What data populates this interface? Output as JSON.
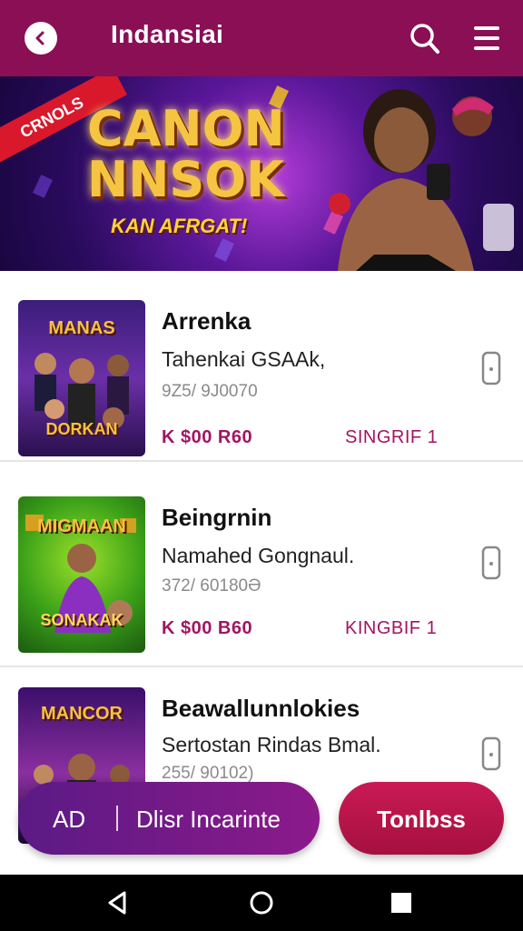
{
  "header": {
    "title": "Indansiai",
    "back_icon": "back-arrow-icon",
    "search_icon": "search-icon",
    "menu_icon": "hamburger-menu-icon",
    "bg_color": "#8a0f55"
  },
  "banner": {
    "ribbon": "CRNOLS",
    "headline_1": "CANON",
    "headline_2": "NNSOK",
    "subline": "KAN AFRGAT!"
  },
  "items": [
    {
      "thumb_top": "MANAS",
      "thumb_bottom": "DORKAN",
      "title": "Arrenka",
      "description": "Tahenkai GSAAk,",
      "meta": "9Z5/  9J0070",
      "price": "K $00 R60",
      "tag": "SINGRIF 1",
      "action_icon": "phone-icon"
    },
    {
      "thumb_top": "MIGMAAN",
      "thumb_bottom": "SONAKAK",
      "title": "Beingrnin",
      "description": "Namahed Gongnaul.",
      "meta": "372/  60180Ә",
      "price": "K $00 B60",
      "tag": "KINGBIF 1",
      "action_icon": "phone-icon"
    },
    {
      "thumb_top": "MANCOR",
      "thumb_bottom": "",
      "title": "Beawallunnlokies",
      "description": "Sertostan Rindas Bmal.",
      "meta": "255/  90102)",
      "price": "",
      "tag": "",
      "action_icon": "phone-icon"
    }
  ],
  "bottom_bar": {
    "ad_label": "AD",
    "ad_text": "Dlisr Incarinte",
    "right_button": "Tonlbss"
  },
  "system_nav": {
    "back": "nav-back-icon",
    "home": "nav-home-icon",
    "recents": "nav-recents-icon"
  }
}
